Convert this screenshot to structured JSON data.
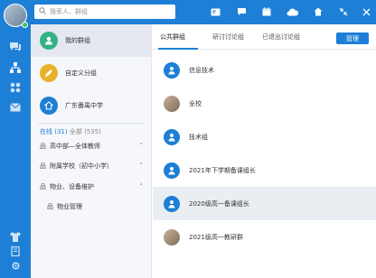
{
  "search": {
    "placeholder": "搜索人、群组"
  },
  "rail": {
    "icons": [
      "avatar-icon",
      "chat-icon",
      "contacts-icon",
      "apps-icon",
      "mail-icon",
      "tshirt-icon",
      "bookmark-icon",
      "settings-icon"
    ]
  },
  "toolbar": {
    "icons": [
      "card-icon",
      "message-icon",
      "calendar-icon",
      "cloud-icon",
      "home-icon",
      "shrink-icon",
      "close-icon"
    ]
  },
  "groups": {
    "items": [
      {
        "label": "我的群组",
        "color": "#35b28a"
      },
      {
        "label": "自定义分组",
        "color": "#e8b22a"
      },
      {
        "label": "广东番禺中学",
        "color": "#1d7fd6"
      }
    ]
  },
  "status": {
    "online": "在线 (31)",
    "all": "全部 (535)"
  },
  "tree": [
    {
      "label": "高中部—全体教师",
      "expanded": false
    },
    {
      "label": "附属学校（初中小学）",
      "expanded": false
    },
    {
      "label": "物业、设备维护",
      "expanded": true
    },
    {
      "label": "物业管理",
      "child": true
    }
  ],
  "tabs": [
    "公共群组",
    "研讨讨论组",
    "已退出讨论组"
  ],
  "manage_label": "管理",
  "list": [
    {
      "name": "信息技术",
      "photo": false
    },
    {
      "name": "全校",
      "photo": true
    },
    {
      "name": "技术组",
      "photo": false
    },
    {
      "name": "2021年下学期备课组长",
      "photo": false
    },
    {
      "name": "2020级高一备课组长",
      "photo": false,
      "selected": true
    },
    {
      "name": "2021级高一教研群",
      "photo": true
    }
  ],
  "colors": {
    "accent": "#1d7fd6"
  }
}
